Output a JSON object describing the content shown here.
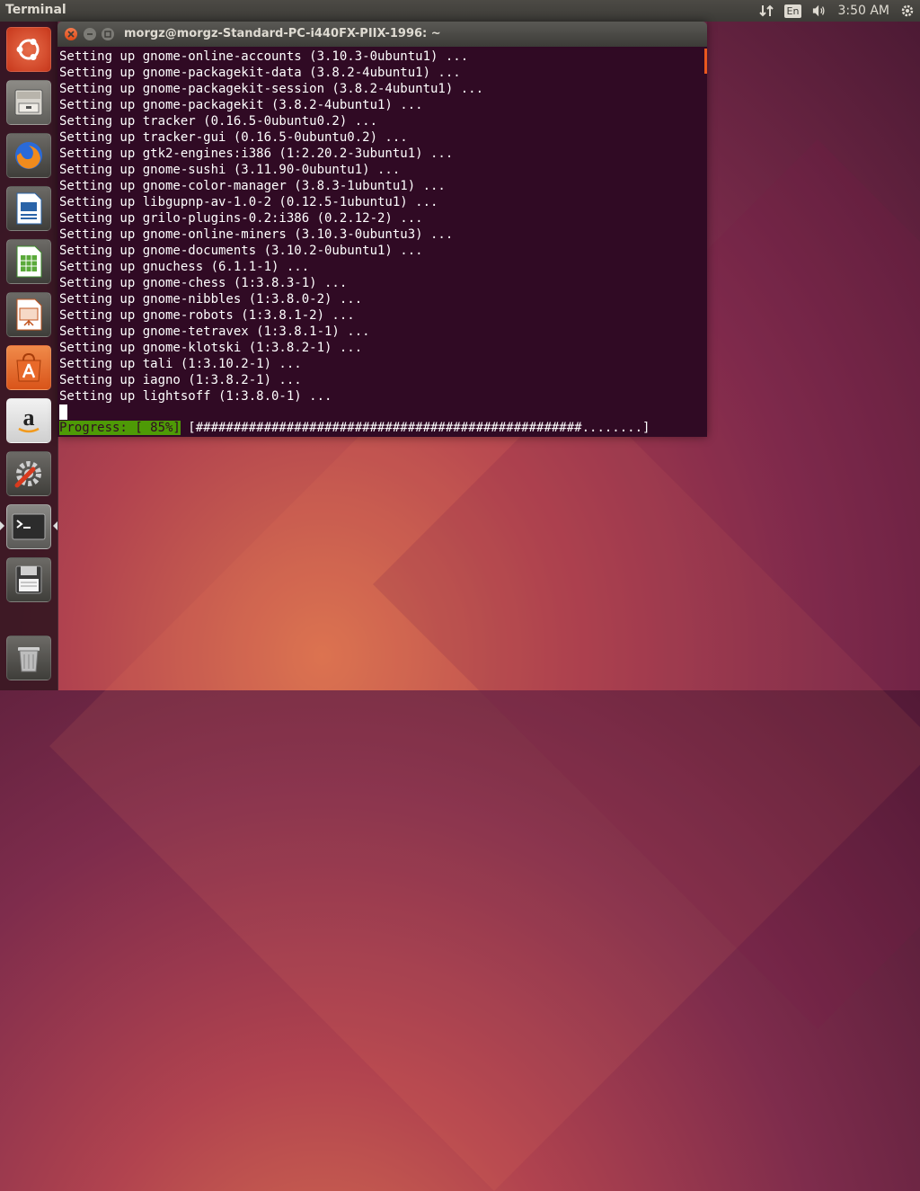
{
  "top_panel": {
    "app_title": "Terminal",
    "keyboard_layout": "En",
    "clock": "3:50 AM"
  },
  "launcher": {
    "items": [
      {
        "name": "Ubuntu Dash",
        "icon": "ubuntu-logo-icon"
      },
      {
        "name": "Files",
        "icon": "file-cabinet-icon"
      },
      {
        "name": "Firefox Web Browser",
        "icon": "firefox-icon"
      },
      {
        "name": "LibreOffice Writer",
        "icon": "writer-icon"
      },
      {
        "name": "LibreOffice Calc",
        "icon": "calc-icon"
      },
      {
        "name": "LibreOffice Impress",
        "icon": "impress-icon"
      },
      {
        "name": "Ubuntu Software Center",
        "icon": "software-center-icon"
      },
      {
        "name": "Amazon",
        "icon": "amazon-icon"
      },
      {
        "name": "System Settings",
        "icon": "settings-icon"
      },
      {
        "name": "Terminal",
        "icon": "terminal-icon",
        "active": true
      },
      {
        "name": "Disk",
        "icon": "floppy-disk-icon"
      },
      {
        "name": "Trash",
        "icon": "trash-icon"
      }
    ]
  },
  "terminal": {
    "title": "morgz@morgz-Standard-PC-i440FX-PIIX-1996: ~",
    "lines": [
      "Setting up gnome-online-accounts (3.10.3-0ubuntu1) ...",
      "Setting up gnome-packagekit-data (3.8.2-4ubuntu1) ...",
      "Setting up gnome-packagekit-session (3.8.2-4ubuntu1) ...",
      "Setting up gnome-packagekit (3.8.2-4ubuntu1) ...",
      "Setting up tracker (0.16.5-0ubuntu0.2) ...",
      "Setting up tracker-gui (0.16.5-0ubuntu0.2) ...",
      "Setting up gtk2-engines:i386 (1:2.20.2-3ubuntu1) ...",
      "Setting up gnome-sushi (3.11.90-0ubuntu1) ...",
      "Setting up gnome-color-manager (3.8.3-1ubuntu1) ...",
      "Setting up libgupnp-av-1.0-2 (0.12.5-1ubuntu1) ...",
      "Setting up grilo-plugins-0.2:i386 (0.2.12-2) ...",
      "Setting up gnome-online-miners (3.10.3-0ubuntu3) ...",
      "Setting up gnome-documents (3.10.2-0ubuntu1) ...",
      "Setting up gnuchess (6.1.1-1) ...",
      "Setting up gnome-chess (1:3.8.3-1) ...",
      "Setting up gnome-nibbles (1:3.8.0-2) ...",
      "Setting up gnome-robots (1:3.8.1-2) ...",
      "Setting up gnome-tetravex (1:3.8.1-1) ...",
      "Setting up gnome-klotski (1:3.8.2-1) ...",
      "Setting up tali (1:3.10.2-1) ...",
      "Setting up iagno (1:3.8.2-1) ...",
      "Setting up lightsoff (1:3.8.0-1) ..."
    ],
    "progress_label": "Progress: [ 85%]",
    "progress_bar": " [###################################################........]",
    "progress_percent": 85
  },
  "colors": {
    "terminal_bg": "#300a24",
    "progress_green": "#4e9a06",
    "ubuntu_orange": "#e9571e"
  }
}
